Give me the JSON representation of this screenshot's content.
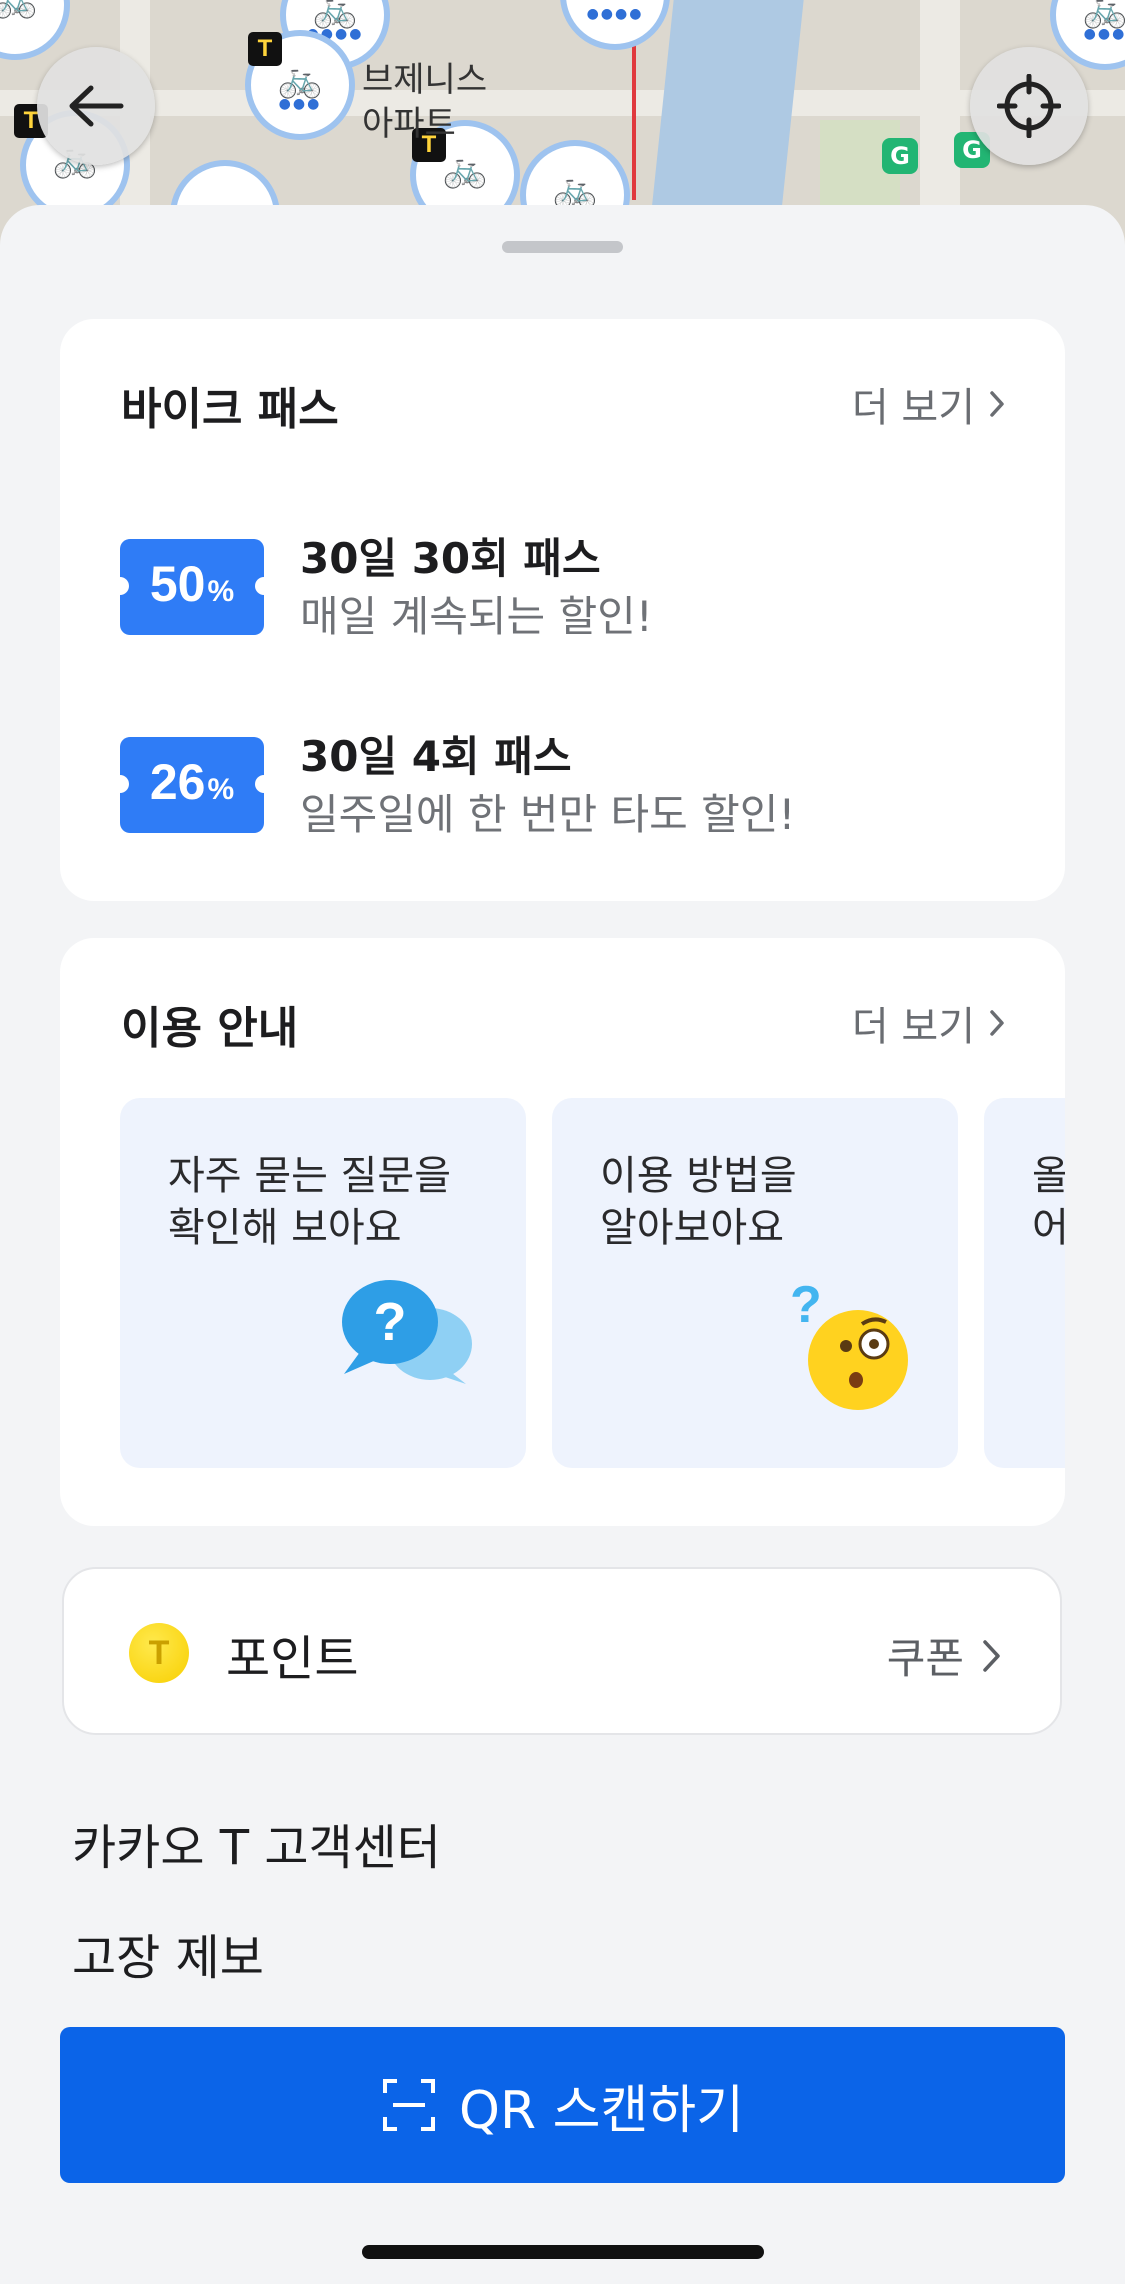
{
  "map": {
    "place_label_line1": "브제니스",
    "place_label_line2": "아파트"
  },
  "bike_pass": {
    "title": "바이크 패스",
    "more_label": "더 보기",
    "items": [
      {
        "discount": "50",
        "unit": "%",
        "name": "30일 30회 패스",
        "desc": "매일 계속되는 할인!"
      },
      {
        "discount": "26",
        "unit": "%",
        "name": "30일 4회 패스",
        "desc": "일주일에 한 번만 타도 할인!"
      }
    ]
  },
  "guide": {
    "title": "이용 안내",
    "more_label": "더 보기",
    "cards": [
      {
        "text": "자주 묻는 질문을\n확인해 보아요",
        "icon": "question-bubbles-icon"
      },
      {
        "text": "이용 방법을\n알아보아요",
        "icon": "curious-emoji-icon"
      },
      {
        "text": "올\n어",
        "icon": ""
      }
    ]
  },
  "points": {
    "coin_letter": "T",
    "label": "포인트",
    "coupon_label": "쿠폰"
  },
  "links": {
    "customer_center": "카카오 T 고객센터",
    "report_fault": "고장 제보"
  },
  "qr_button": {
    "label": "QR 스캔하기"
  },
  "colors": {
    "accent": "#0b64e8",
    "coupon": "#2f7cf6",
    "guide_card_bg": "#eef3fd"
  }
}
